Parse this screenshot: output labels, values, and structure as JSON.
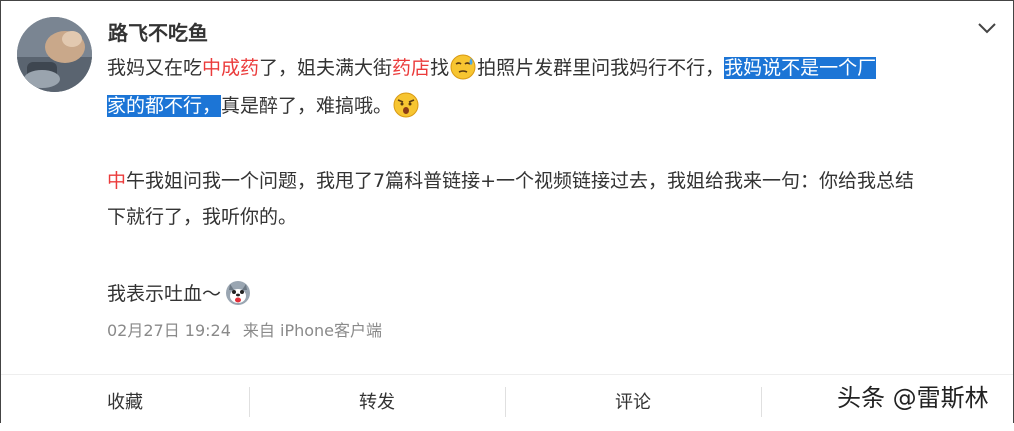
{
  "user": {
    "name": "路飞不吃鱼"
  },
  "post": {
    "p1": {
      "s1": "我妈又在吃",
      "s2": "中成药",
      "s3": "了，姐夫满大街",
      "s4": "药店",
      "s5": "找",
      "s6": "拍照片发群里问我妈行不行，",
      "s7": "我妈说不是一个厂",
      "s8": "家的都不行，",
      "s9": "真是醉了，难搞哦。"
    },
    "p2": {
      "s1": "中",
      "s2": "午我姐问我一个问题，我甩了7篇科普链接+一个视频链接过去，我姐给我来一句：你给我总结",
      "s3": "下就行了，我听你的。"
    },
    "p3": {
      "s1": "我表示吐血～"
    },
    "emojis": [
      "sweat-emoji",
      "shocked-emoji",
      "husky-spit-blood-emoji"
    ]
  },
  "meta": {
    "date": "02月27日 19:24",
    "source": "来自 iPhone客户端"
  },
  "actions": {
    "favorite": "收藏",
    "repost": "转发",
    "comment": "评论"
  },
  "watermark": "头条 @雷斯林",
  "colors": {
    "highlight_bg": "#1c75d6",
    "keyword_red": "#eb3b3b",
    "meta_gray": "#8a8a8a"
  }
}
